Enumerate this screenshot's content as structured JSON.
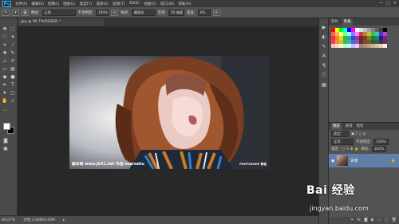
{
  "app": {
    "logo": "Ps"
  },
  "menubar": {
    "items": [
      "文件(F)",
      "编辑(E)",
      "图像(I)",
      "图层(L)",
      "类型(Y)",
      "选择(S)",
      "滤镜(T)",
      "3D(D)",
      "视图(V)",
      "窗口(W)",
      "帮助(H)"
    ],
    "min": "—",
    "max": "□",
    "close": "✕"
  },
  "options": {
    "mode_label": "模式:",
    "mode_value": "正常",
    "opacity_label": "不透明度:",
    "opacity_value": "100%",
    "style_label": "样式:",
    "style_value": "绷紧短",
    "area_label": "区域:",
    "area_value": "50 像素",
    "tolerance_label": "容差:",
    "tolerance_value": "0%"
  },
  "document": {
    "tab_title": ".jpg @ 66.7%(RGB/8) *"
  },
  "status": {
    "zoom": "66.67%",
    "doc_size": "文档:2.00M/2.00M"
  },
  "photo": {
    "watermark_left": "脚本网  www.jb51.net  作者:scarsahu",
    "watermark_right": "PHOTOSHOP 教程"
  },
  "swatches": {
    "tabs": [
      "颜色",
      "色板"
    ],
    "colors": [
      "#ff0000",
      "#ffff00",
      "#00ff00",
      "#00ffff",
      "#0000ff",
      "#ff00ff",
      "#ffffff",
      "#e0e0e0",
      "#c0c0c0",
      "#a0a0a0",
      "#808080",
      "#606060",
      "#404040",
      "#000000",
      "#ff6060",
      "#ffb060",
      "#ffff80",
      "#80ff80",
      "#80ffff",
      "#8080ff",
      "#ff80ff",
      "#c04040",
      "#c08040",
      "#c0c040",
      "#40c040",
      "#40c0c0",
      "#4040c0",
      "#c040c0",
      "#ff3030",
      "#ff8030",
      "#e0e000",
      "#30c030",
      "#30a0c0",
      "#3050c0",
      "#a030c0",
      "#802020",
      "#804020",
      "#808020",
      "#208020",
      "#208080",
      "#202080",
      "#802080",
      "#f04060",
      "#f09040",
      "#d0c040",
      "#50b060",
      "#40b0b0",
      "#4070d0",
      "#9050c0",
      "#603030",
      "#705030",
      "#606030",
      "#306030",
      "#306060",
      "#303060",
      "#603060",
      "#ffc0c0",
      "#ffe0c0",
      "#ffffc0",
      "#c0ffc0",
      "#c0ffff",
      "#c0c0ff",
      "#ffc0ff",
      "#a08070",
      "#b09070",
      "#c0a080",
      "#d0b090",
      "#e0c0a0",
      "#f0d0b0",
      "#fff0e0"
    ]
  },
  "layers": {
    "tabs": [
      "图层",
      "通道",
      "路径"
    ],
    "kind_label": "类型",
    "mode_value": "正常",
    "opacity_label": "不透明度:",
    "opacity_value": "100%",
    "lock_label": "锁定:",
    "fill_label": "填充:",
    "fill_value": "100%",
    "layer_name": "背景"
  },
  "brand": {
    "baidu": "Bai 经验",
    "jingyan": "jingyan.baidu.com"
  }
}
